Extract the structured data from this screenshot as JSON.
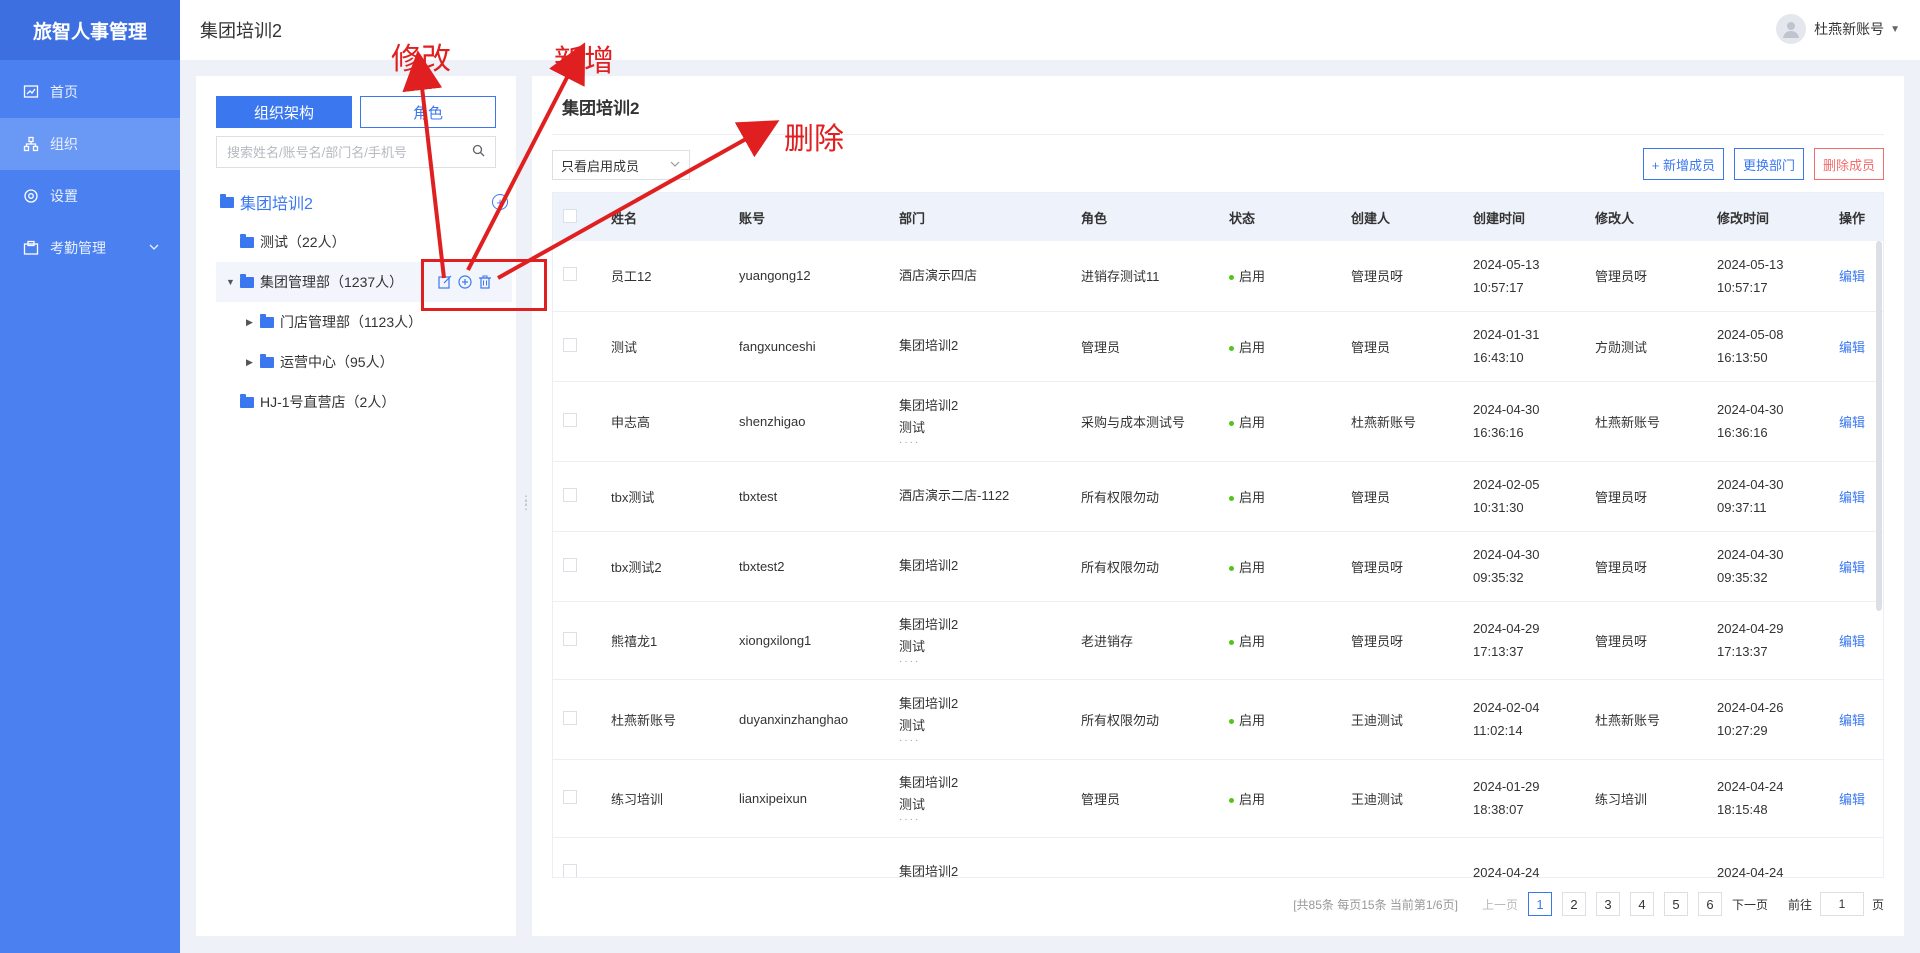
{
  "app": {
    "brand": "旅智人事管理",
    "accent": "#4a80f0"
  },
  "sidebar": {
    "items": [
      {
        "label": "首页",
        "icon": "chart-icon"
      },
      {
        "label": "组织",
        "icon": "org-icon",
        "active": true
      },
      {
        "label": "设置",
        "icon": "gear-icon"
      },
      {
        "label": "考勤管理",
        "icon": "attendance-icon",
        "expandable": true
      }
    ]
  },
  "header": {
    "title": "集团培训2",
    "user": "杜燕新账号"
  },
  "left": {
    "tabs": [
      "组织架构",
      "角色"
    ],
    "search_placeholder": "搜索姓名/账号名/部门名/手机号",
    "tree": {
      "root": "集团培训2",
      "nodes": [
        {
          "label": "测试（22人）"
        },
        {
          "label": "集团管理部（1237人）"
        },
        {
          "label": "门店管理部（1123人）"
        },
        {
          "label": "运营中心（95人）"
        },
        {
          "label": "HJ-1号直营店（2人）"
        }
      ]
    }
  },
  "main": {
    "title": "集团培训2",
    "filter": "只看启用成员",
    "buttons": {
      "add": "+ 新增成员",
      "change": "更换部门",
      "delete": "删除成员"
    },
    "columns": [
      "姓名",
      "账号",
      "部门",
      "角色",
      "状态",
      "创建人",
      "创建时间",
      "修改人",
      "修改时间",
      "操作"
    ],
    "rows": [
      {
        "name": "员工12",
        "account": "yuangong12",
        "dept": [
          "酒店演示四店"
        ],
        "more": false,
        "role": "进销存测试11",
        "status": "启用",
        "creator": "管理员呀",
        "created": [
          "2024-05-13",
          "10:57:17"
        ],
        "modifier": "管理员呀",
        "modified": [
          "2024-05-13",
          "10:57:17"
        ],
        "op": "编辑"
      },
      {
        "name": "测试",
        "account": "fangxunceshi",
        "dept": [
          "集团培训2"
        ],
        "more": false,
        "role": "管理员",
        "status": "启用",
        "creator": "管理员",
        "created": [
          "2024-01-31",
          "16:43:10"
        ],
        "modifier": "方勋测试",
        "modified": [
          "2024-05-08",
          "16:13:50"
        ],
        "op": "编辑"
      },
      {
        "name": "申志高",
        "account": "shenzhigao",
        "dept": [
          "集团培训2",
          "测试"
        ],
        "more": true,
        "role": "采购与成本测试号",
        "status": "启用",
        "creator": "杜燕新账号",
        "created": [
          "2024-04-30",
          "16:36:16"
        ],
        "modifier": "杜燕新账号",
        "modified": [
          "2024-04-30",
          "16:36:16"
        ],
        "op": "编辑"
      },
      {
        "name": "tbx测试",
        "account": "tbxtest",
        "dept": [
          "酒店演示二店-1122"
        ],
        "more": false,
        "role": "所有权限勿动",
        "status": "启用",
        "creator": "管理员",
        "created": [
          "2024-02-05",
          "10:31:30"
        ],
        "modifier": "管理员呀",
        "modified": [
          "2024-04-30",
          "09:37:11"
        ],
        "op": "编辑"
      },
      {
        "name": "tbx测试2",
        "account": "tbxtest2",
        "dept": [
          "集团培训2"
        ],
        "more": false,
        "role": "所有权限勿动",
        "status": "启用",
        "creator": "管理员呀",
        "created": [
          "2024-04-30",
          "09:35:32"
        ],
        "modifier": "管理员呀",
        "modified": [
          "2024-04-30",
          "09:35:32"
        ],
        "op": "编辑"
      },
      {
        "name": "熊禧龙1",
        "account": "xiongxilong1",
        "dept": [
          "集团培训2",
          "测试"
        ],
        "more": true,
        "role": "老进销存",
        "status": "启用",
        "creator": "管理员呀",
        "created": [
          "2024-04-29",
          "17:13:37"
        ],
        "modifier": "管理员呀",
        "modified": [
          "2024-04-29",
          "17:13:37"
        ],
        "op": "编辑"
      },
      {
        "name": "杜燕新账号",
        "account": "duyanxinzhanghao",
        "dept": [
          "集团培训2",
          "测试"
        ],
        "more": true,
        "role": "所有权限勿动",
        "status": "启用",
        "creator": "王迪测试",
        "created": [
          "2024-02-04",
          "11:02:14"
        ],
        "modifier": "杜燕新账号",
        "modified": [
          "2024-04-26",
          "10:27:29"
        ],
        "op": "编辑"
      },
      {
        "name": "练习培训",
        "account": "lianxipeixun",
        "dept": [
          "集团培训2",
          "测试"
        ],
        "more": true,
        "role": "管理员",
        "status": "启用",
        "creator": "王迪测试",
        "created": [
          "2024-01-29",
          "18:38:07"
        ],
        "modifier": "练习培训",
        "modified": [
          "2024-04-24",
          "18:15:48"
        ],
        "op": "编辑"
      },
      {
        "name": "",
        "account": "",
        "dept": [
          "集团培训2"
        ],
        "more": false,
        "role": "",
        "status": "",
        "creator": "",
        "created": [
          "2024-04-24",
          ""
        ],
        "modifier": "",
        "modified": [
          "2024-04-24",
          ""
        ],
        "op": ""
      }
    ],
    "pagination": {
      "info": "[共85条 每页15条 当前第1/6页]",
      "prev": "上一页",
      "pages": [
        "1",
        "2",
        "3",
        "4",
        "5",
        "6"
      ],
      "current": "1",
      "next": "下一页",
      "goto_label": "前往",
      "goto_value": "1",
      "goto_suffix": "页"
    }
  },
  "annotations": {
    "edit": "修改",
    "add": "新增",
    "delete": "删除",
    "color": "#e02020"
  }
}
